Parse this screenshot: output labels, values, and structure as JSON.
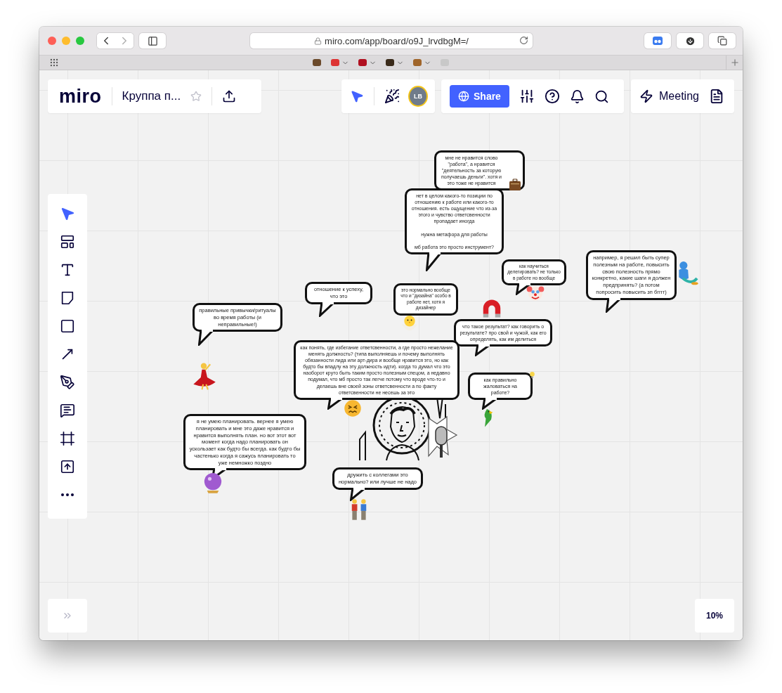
{
  "browser": {
    "url": "miro.com/app/board/o9J_lrvdbgM=/",
    "bookmarks": [
      {
        "kind": "hedgehog",
        "dropdown": false
      },
      {
        "kind": "mushroom",
        "dropdown": true
      },
      {
        "kind": "rose",
        "dropdown": true
      },
      {
        "kind": "chest",
        "dropdown": true
      },
      {
        "kind": "box",
        "dropdown": true
      },
      {
        "kind": "envelope",
        "dropdown": false
      }
    ]
  },
  "board_header": {
    "logo": "miro",
    "title": "Круппа п...",
    "starred": false
  },
  "collab": {
    "avatar": "LB"
  },
  "share": {
    "label": "Share"
  },
  "meeting": {
    "label": "Meeting"
  },
  "tools": [
    {
      "kind": "select",
      "selected": true
    },
    {
      "kind": "templates",
      "selected": false
    },
    {
      "kind": "text",
      "selected": false
    },
    {
      "kind": "sticky",
      "selected": false
    },
    {
      "kind": "shape",
      "selected": false
    },
    {
      "kind": "arrow",
      "selected": false
    },
    {
      "kind": "pen",
      "selected": false
    },
    {
      "kind": "comment",
      "selected": false
    },
    {
      "kind": "frame",
      "selected": false
    },
    {
      "kind": "upload",
      "selected": false
    },
    {
      "kind": "more",
      "selected": false
    }
  ],
  "bubbles": [
    {
      "text": "мне не нравится слово \"работа\", а нравится \"деятельность за которую получаешь деньги\". хотя и это тоже не нравится"
    },
    {
      "text": "нет в целом какого-то позиции по отношению к работе или какого-то отношения. есть ощущение что из-за этого и чувство ответсвенности пропадает иногда\n\nнужна метафора для работы\n\nмб работа это просто инструмент?"
    },
    {
      "text": "отношение к успеху, что это"
    },
    {
      "text": "это нормально вообще что и \"дизайна\" особо в работе нет, хотя я дизайнер"
    },
    {
      "text": "как научиться делегировать? не только в работе но вообще"
    },
    {
      "text": "например, я решил быть супер полезным на работе, повысить свою полезность прямо конкретно, какие шаги я должен предпринять? (а потом попросить повысить зп бгггг)"
    },
    {
      "text": "правильные привычки/ритуалы во время работы (и неправильные!)"
    },
    {
      "text": "что такое результат? как говорить о результате? про свой и чужой, как его определять, как им делиться"
    },
    {
      "text": "как понять, где избегание ответсвенности, а где просто нежелание менять должность? (типа выполняешь и почему выполнять обязанности лида или арт-дира и вообще нравится это, но как будто бы впадлу на эту должность идти). когда то думал что это наоборот круто быть таким просто полезным спецом, а недавно подумал, что мб просто так легче потому что вроде что-то и делаешь вне своей зоны ответсвенности а по факту ответсвенности не несешь за это"
    },
    {
      "text": "как правильно жаловаться на работе?"
    },
    {
      "text": "я не умею планировать. вернее я умею планировать и мне это даже нравится и нравится выполнять план. но вот этот вот момент когда надо планировать он ускользает как будто бы всегда. как будто бы частенько когда я сажусь планировать то уже немножко поздно"
    },
    {
      "text": "дружить с коллегами это нормально? или лучше не надо"
    }
  ],
  "stickers": [
    {
      "kind": "suitcase"
    },
    {
      "kind": "chick"
    },
    {
      "kind": "clown"
    },
    {
      "kind": "genie"
    },
    {
      "kind": "dancer"
    },
    {
      "kind": "magnet"
    },
    {
      "kind": "angry-face"
    },
    {
      "kind": "parrot"
    },
    {
      "kind": "lightbulb"
    },
    {
      "kind": "crystal-ball"
    },
    {
      "kind": "people"
    }
  ],
  "zoom": "10%"
}
